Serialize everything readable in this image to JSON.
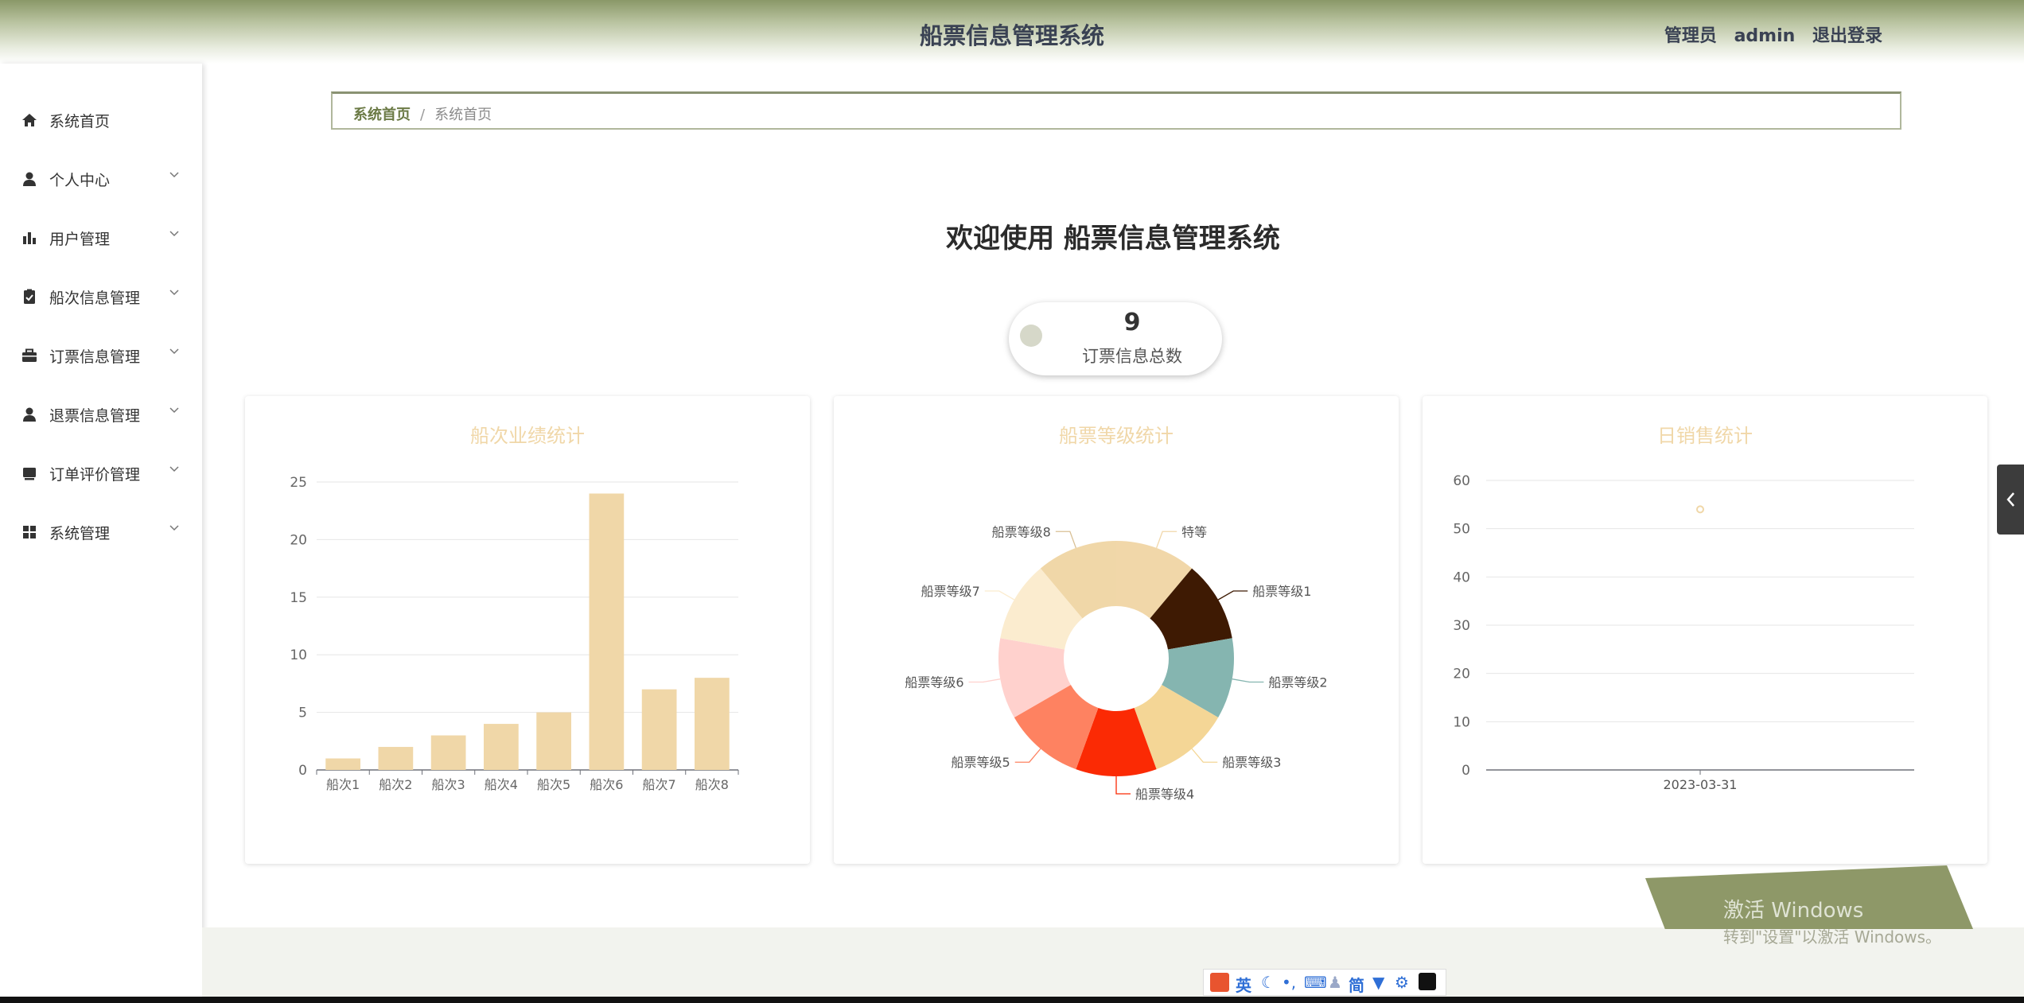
{
  "header": {
    "title": "船票信息管理系统",
    "role": "管理员",
    "username": "admin",
    "logout": "退出登录"
  },
  "sidebar": {
    "items": [
      {
        "label": "系统首页",
        "icon": "home-icon"
      },
      {
        "label": "个人中心",
        "icon": "user-icon"
      },
      {
        "label": "用户管理",
        "icon": "bar-chart-icon"
      },
      {
        "label": "船次信息管理",
        "icon": "clipboard-check-icon"
      },
      {
        "label": "订票信息管理",
        "icon": "briefcase-icon"
      },
      {
        "label": "退票信息管理",
        "icon": "user-icon"
      },
      {
        "label": "订单评价管理",
        "icon": "inbox-icon"
      },
      {
        "label": "系统管理",
        "icon": "grid-icon"
      }
    ]
  },
  "breadcrumb": {
    "home": "系统首页",
    "separator": "/",
    "current": "系统首页"
  },
  "welcome": "欢迎使用 船票信息管理系统",
  "stat": {
    "value": "9",
    "label": "订票信息总数"
  },
  "colors": {
    "accent": "#8a9868",
    "bar": "#f0d7a8"
  },
  "chart_data": [
    {
      "type": "bar",
      "title": "船次业绩统计",
      "categories": [
        "船次1",
        "船次2",
        "船次3",
        "船次4",
        "船次5",
        "船次6",
        "船次7",
        "船次8"
      ],
      "values": [
        1,
        2,
        3,
        4,
        5,
        24,
        7,
        8
      ],
      "yticks": [
        0,
        5,
        10,
        15,
        20,
        25
      ],
      "ylim": [
        0,
        25
      ],
      "grid": true
    },
    {
      "type": "pie",
      "title": "船票等级统计",
      "labels": [
        "特等",
        "船票等级1",
        "船票等级2",
        "船票等级3",
        "船票等级4",
        "船票等级5",
        "船票等级6",
        "船票等级7",
        "船票等级8"
      ],
      "values": [
        1,
        1,
        1,
        1,
        1,
        1,
        1,
        1,
        1
      ],
      "colors": [
        "#f1d7a9",
        "#3e1a03",
        "#85b5b0",
        "#f4d696",
        "#fb2a04",
        "#fe8261",
        "#ffd1cd",
        "#fbeccf",
        "#f0d7a8"
      ],
      "donut": true
    },
    {
      "type": "scatter",
      "title": "日销售统计",
      "x": [
        "2023-03-31"
      ],
      "values": [
        54
      ],
      "yticks": [
        0,
        10,
        20,
        30,
        40,
        50,
        60
      ],
      "ylim": [
        0,
        60
      ],
      "grid": true
    }
  ],
  "watermark": {
    "line1": "激活 Windows",
    "line2": "转到\"设置\"以激活 Windows。"
  },
  "ime": {
    "lang": "英",
    "mode": "简"
  }
}
